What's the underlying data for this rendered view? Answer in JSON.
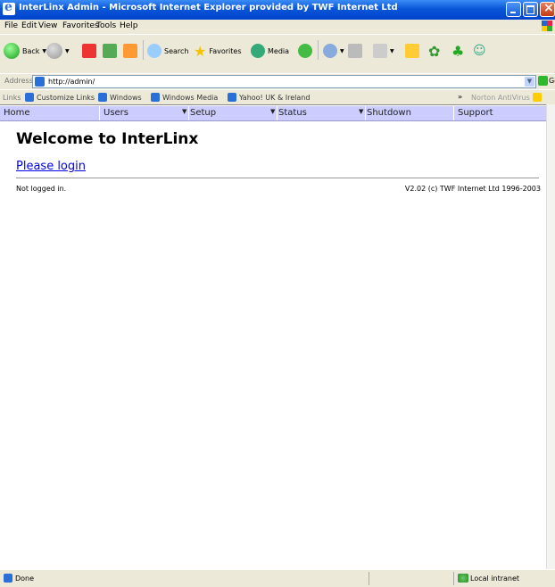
{
  "window": {
    "title": "InterLinx Admin - Microsoft Internet Explorer provided by TWF Internet Ltd"
  },
  "menu": {
    "items": [
      "File",
      "Edit",
      "View",
      "Favorites",
      "Tools",
      "Help"
    ]
  },
  "toolbar": {
    "back": "Back",
    "search": "Search",
    "favorites": "Favorites",
    "media": "Media"
  },
  "address": {
    "label": "Address",
    "url": "http://admin/",
    "go": "Go"
  },
  "links": {
    "label": "Links",
    "items": [
      "Customize Links",
      "Windows",
      "Windows Media",
      "Yahoo! UK & Ireland"
    ],
    "norton": "Norton AntiVirus",
    "chevron": "»"
  },
  "nav": {
    "items": [
      "Home",
      "Users",
      "Setup",
      "Status",
      "Shutdown",
      "Support"
    ],
    "dropdown_arrow": "▼"
  },
  "page": {
    "heading": "Welcome to InterLinx",
    "login_link": "Please login",
    "login_status": "Not logged in.",
    "version": "V2.02 (c) TWF Internet Ltd 1996-2003"
  },
  "statusbar": {
    "status": "Done",
    "zone": "Local intranet"
  },
  "colors": {
    "nav_bg": "#ccccff",
    "link": "#0000ee",
    "title_bar": "#0a56d8"
  }
}
